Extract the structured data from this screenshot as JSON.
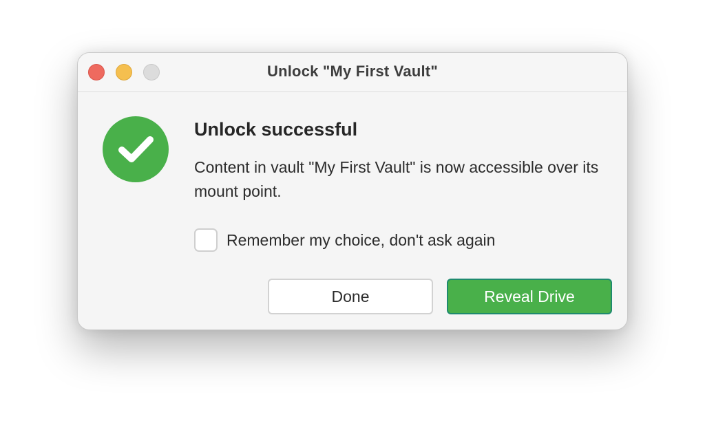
{
  "window": {
    "title": "Unlock \"My First Vault\""
  },
  "dialog": {
    "heading": "Unlock successful",
    "message": "Content in vault \"My First Vault\" is now accessible over its mount point.",
    "status_icon": "checkmark-circle-icon",
    "checkbox": {
      "label": "Remember my choice, don't ask again",
      "checked": false
    },
    "buttons": {
      "done_label": "Done",
      "reveal_label": "Reveal Drive"
    }
  },
  "colors": {
    "accent": "#49b04a",
    "close": "#ee6a5f",
    "minimize": "#f5bf4f",
    "zoom_disabled": "#dcdcdc"
  }
}
